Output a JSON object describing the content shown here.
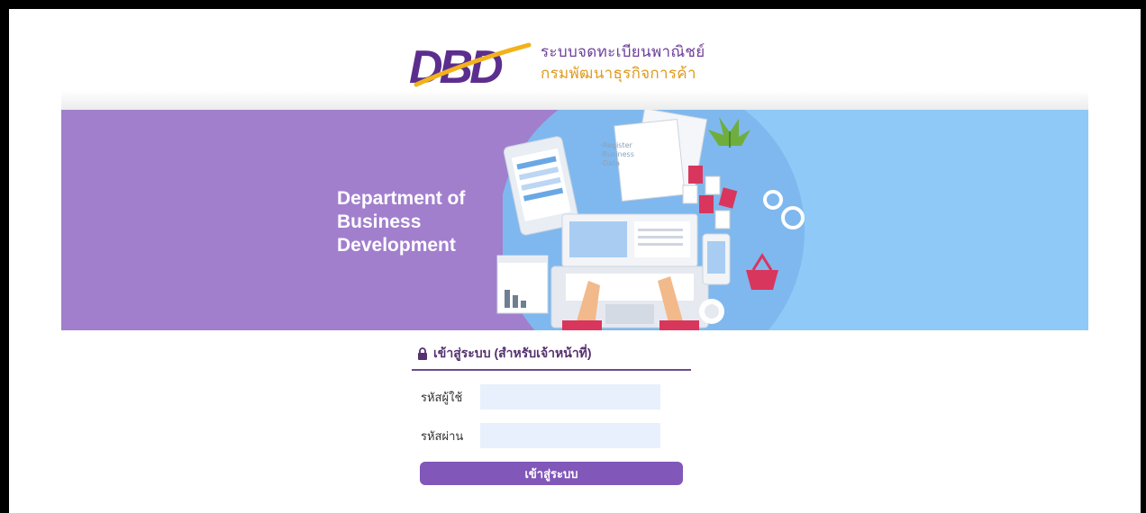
{
  "header": {
    "logo_text": "DBD",
    "org_name_th_line1": "ระบบจดทะเบียนพาณิชย์",
    "org_name_th_line2": "กรมพัฒนาธุรกิจการค้า"
  },
  "banner": {
    "title_lines": [
      "Department of",
      "Business",
      "Development"
    ],
    "document_text": [
      "-Register",
      "-Business",
      "-Data"
    ],
    "colors": {
      "left": "#a17fcd",
      "right": "#8ec9f7",
      "circle": "#7fb8ee"
    }
  },
  "login": {
    "heading": "เข้าสู่ระบบ (สำหรับเจ้าหน้าที่)",
    "username_label": "รหัสผู้ใช้",
    "username_value": "",
    "password_label": "รหัสผ่าน",
    "password_value": "",
    "submit_label": "เข้าสู่ระบบ",
    "accent_color": "#8157b9"
  }
}
